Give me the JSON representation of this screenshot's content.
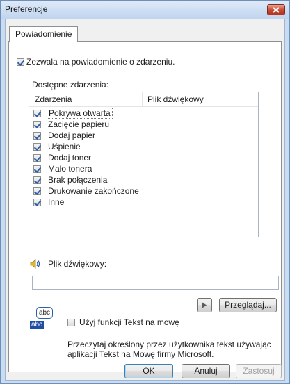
{
  "window": {
    "title": "Preferencje"
  },
  "tabs": [
    {
      "label": "Powiadomienie"
    }
  ],
  "notification": {
    "enable_label": "Zezwala na powiadomienie o zdarzeniu.",
    "enable_checked": true
  },
  "events": {
    "section_label": "Dostępne zdarzenia:",
    "columns": [
      "Zdarzenia",
      "Plik dźwiękowy"
    ],
    "items": [
      {
        "label": "Pokrywa otwarta",
        "checked": true
      },
      {
        "label": "Zacięcie papieru",
        "checked": true
      },
      {
        "label": "Dodaj papier",
        "checked": true
      },
      {
        "label": "Uśpienie",
        "checked": true
      },
      {
        "label": "Dodaj toner",
        "checked": true
      },
      {
        "label": "Mało tonera",
        "checked": true
      },
      {
        "label": "Brak połączenia",
        "checked": true
      },
      {
        "label": "Drukowanie zakończone",
        "checked": true
      },
      {
        "label": "Inne",
        "checked": true
      }
    ]
  },
  "sound": {
    "label": "Plik dźwiękowy:",
    "value": "",
    "browse_label": "Przeglądaj...",
    "icon": "speaker-icon"
  },
  "tts": {
    "checkbox_label": "Użyj funkcji Tekst na mowę",
    "checked": false,
    "icon_top": "abc",
    "icon_bottom": "abc",
    "description": "Przeczytaj określony przez użytkownika tekst używając aplikacji Tekst na Mowę firmy Microsoft."
  },
  "footer": {
    "ok": "OK",
    "cancel": "Anuluj",
    "apply": "Zastosuj"
  },
  "colors": {
    "accent": "#2d5ea8",
    "close": "#c6482f",
    "title_bar": "#c9dcf2"
  }
}
